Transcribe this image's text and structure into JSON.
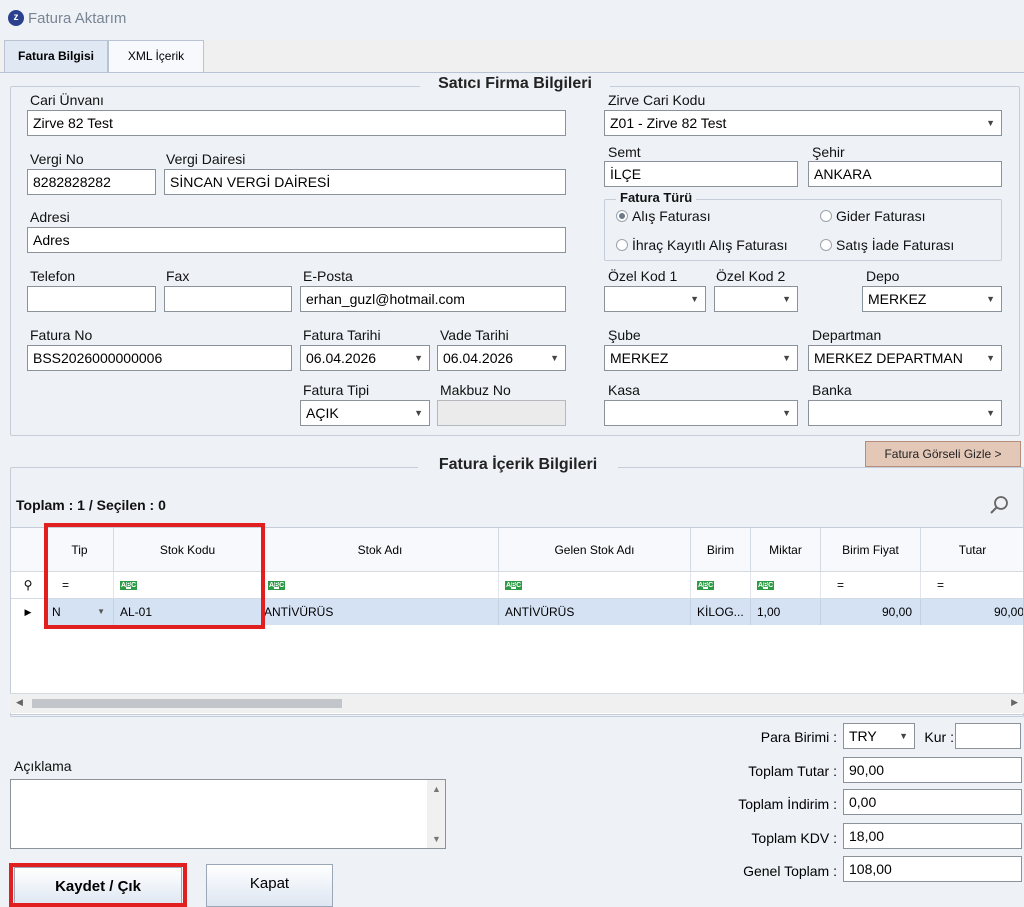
{
  "window": {
    "title": "Fatura Aktarım",
    "icon": "z-app-icon"
  },
  "tabs": [
    {
      "label": "Fatura Bilgisi"
    },
    {
      "label": "XML İçerik"
    }
  ],
  "seller": {
    "group_title": "Satıcı Firma Bilgileri",
    "cari_unvani": {
      "label": "Cari Ünvanı",
      "value": "Zirve 82 Test"
    },
    "vergi_no": {
      "label": "Vergi No",
      "value": "8282828282"
    },
    "vergi_dairesi": {
      "label": "Vergi Dairesi",
      "value": "SİNCAN VERGİ DAİRESİ"
    },
    "adres": {
      "label": "Adresi",
      "value": "Adres"
    },
    "telefon": {
      "label": "Telefon",
      "value": ""
    },
    "fax": {
      "label": "Fax",
      "value": ""
    },
    "eposta": {
      "label": "E-Posta",
      "value": "erhan_guzl@hotmail.com"
    },
    "fatura_no": {
      "label": "Fatura No",
      "value": "BSS2026000000006"
    },
    "fatura_tarihi": {
      "label": "Fatura Tarihi",
      "value": "06.04.2026"
    },
    "vade_tarihi": {
      "label": "Vade Tarihi",
      "value": "06.04.2026"
    },
    "fatura_tipi": {
      "label": "Fatura Tipi",
      "value": "AÇIK"
    },
    "makbuz_no": {
      "label": "Makbuz No",
      "value": ""
    },
    "zirve_cari_kodu": {
      "label": "Zirve Cari Kodu",
      "value": "Z01 - Zirve 82 Test"
    },
    "semt": {
      "label": "Semt",
      "value": "İLÇE"
    },
    "sehir": {
      "label": "Şehir",
      "value": "ANKARA"
    },
    "fatura_turu": {
      "label": "Fatura Türü",
      "options": [
        "Alış Faturası",
        "Gider Faturası",
        "İhraç Kayıtlı Alış Faturası",
        "Satış İade Faturası"
      ],
      "selected": "Alış Faturası"
    },
    "ozel_kod_1": {
      "label": "Özel Kod 1",
      "value": ""
    },
    "ozel_kod_2": {
      "label": "Özel Kod 2",
      "value": ""
    },
    "depo": {
      "label": "Depo",
      "value": "MERKEZ"
    },
    "sube": {
      "label": "Şube",
      "value": "MERKEZ"
    },
    "departman": {
      "label": "Departman",
      "value": "MERKEZ DEPARTMAN"
    },
    "kasa": {
      "label": "Kasa",
      "value": ""
    },
    "banka": {
      "label": "Banka",
      "value": ""
    }
  },
  "toggle_image_button": "Fatura Görseli Gizle >",
  "content": {
    "group_title": "Fatura İçerik Bilgileri",
    "summary": "Toplam : 1 / Seçilen : 0",
    "columns": [
      "Tip",
      "Stok Kodu",
      "Stok Adı",
      "Gelen Stok Adı",
      "Birim",
      "Miktar",
      "Birim Fiyat",
      "Tutar"
    ],
    "filter_row": [
      "=",
      "abc",
      "abc",
      "abc",
      "abc",
      "abc",
      "=",
      "="
    ],
    "rows": [
      {
        "tip": "N",
        "stok_kodu": "AL-01",
        "stok_adi": "ANTİVÜRÜS",
        "gelen_stok_adi": "ANTİVÜRÜS",
        "birim": "KİLOG...",
        "miktar": "1,00",
        "birim_fiyat": "90,00",
        "tutar": "90,00"
      }
    ]
  },
  "aciklama": {
    "label": "Açıklama",
    "value": ""
  },
  "totals": {
    "para_birimi": {
      "label": "Para Birimi :",
      "value": "TRY"
    },
    "kur": {
      "label": "Kur :",
      "value": ""
    },
    "toplam_tutar": {
      "label": "Toplam Tutar :",
      "value": "90,00"
    },
    "toplam_indirim": {
      "label": "Toplam İndirim :",
      "value": "0,00"
    },
    "toplam_kdv": {
      "label": "Toplam KDV :",
      "value": "18,00"
    },
    "genel_toplam": {
      "label": "Genel Toplam :",
      "value": "108,00"
    }
  },
  "buttons": {
    "save": "Kaydet / Çık",
    "close": "Kapat"
  },
  "colors": {
    "highlight": "#e21f1f",
    "selected_row": "#d5e2f3",
    "image_button": "#e3c8b8"
  }
}
